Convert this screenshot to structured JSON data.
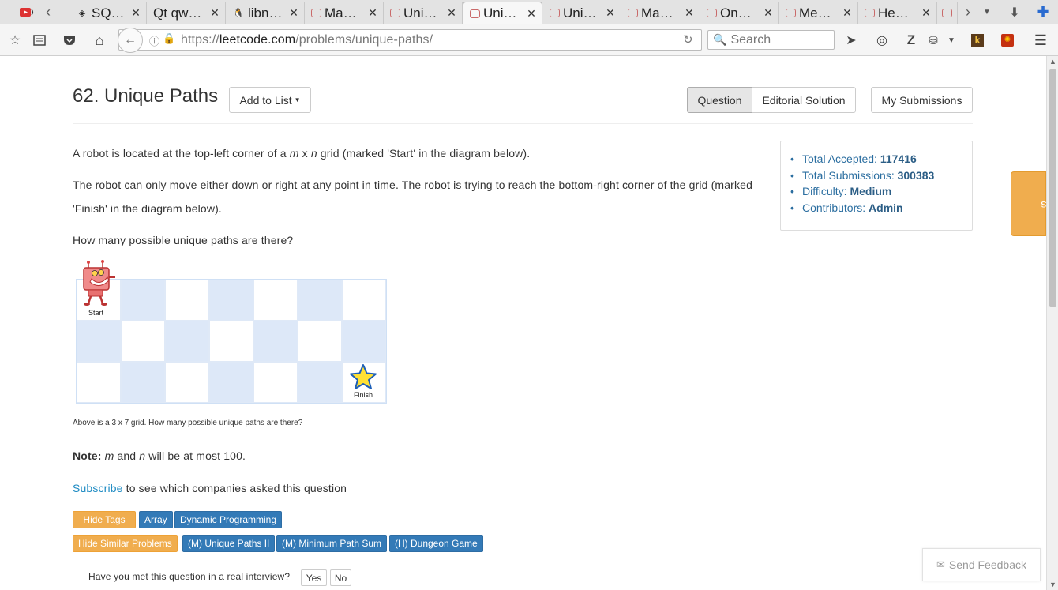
{
  "browser": {
    "tabs": [
      {
        "title": "SQ…",
        "icon": "sql-icon"
      },
      {
        "title": "Qt qw…",
        "icon": "qt-icon"
      },
      {
        "title": "libn…",
        "icon": "linux-icon"
      },
      {
        "title": "Ma…",
        "icon": "leetcode-icon"
      },
      {
        "title": "Uni…",
        "icon": "leetcode-icon"
      },
      {
        "title": "Uni…",
        "icon": "leetcode-icon"
      },
      {
        "title": "Uni…",
        "icon": "leetcode-icon"
      },
      {
        "title": "Ma…",
        "icon": "leetcode-icon"
      },
      {
        "title": "On…",
        "icon": "leetcode-icon"
      },
      {
        "title": "Me…",
        "icon": "leetcode-icon"
      },
      {
        "title": "He…",
        "icon": "leetcode-icon"
      }
    ],
    "url_prefix": "https://",
    "url_host": "leetcode.com",
    "url_path": "/problems/unique-paths/",
    "search_placeholder": "Search"
  },
  "problem": {
    "title": "62. Unique Paths",
    "add_to_list": "Add to List",
    "tabs": {
      "question": "Question",
      "editorial": "Editorial Solution",
      "submissions": "My Submissions"
    },
    "para1_a": "A robot is located at the top-left corner of a ",
    "para1_m": "m",
    "para1_x": " x ",
    "para1_n": "n",
    "para1_b": " grid (marked 'Start' in the diagram below).",
    "para2_line1": "The robot can only move either down or right at any point in time. The robot is trying to reach the bottom-right corner of the grid (marked",
    "para2_line2": "'Finish' in the diagram below).",
    "para3": "How many possible unique paths are there?",
    "grid_start": "Start",
    "grid_finish": "Finish",
    "caption": "Above is a 3 x 7 grid. How many possible unique paths are there?",
    "note_label": "Note:",
    "note_m": "m",
    "note_and": " and ",
    "note_n": "n",
    "note_rest": " will be at most 100.",
    "subscribe_link": "Subscribe",
    "subscribe_rest": " to see which companies asked this question",
    "hide_tags": "Hide Tags",
    "tags": [
      "Array",
      "Dynamic Programming"
    ],
    "hide_similar": "Hide Similar Problems",
    "similar": [
      "(M) Unique Paths II",
      "(M) Minimum Path Sum",
      "(H) Dungeon Game"
    ],
    "interview_q": "Have you met this question in a real interview?",
    "yes": "Yes",
    "no": "No"
  },
  "stats": {
    "accepted_label": "Total Accepted: ",
    "accepted_value": "117416",
    "submissions_label": "Total Submissions: ",
    "submissions_value": "300383",
    "difficulty_label": "Difficulty: ",
    "difficulty_value": "Medium",
    "contributors_label": "Contributors: ",
    "contributors_value": "Admin"
  },
  "sidebar": {
    "notes": "Notes"
  },
  "feedback": {
    "label": "Send Feedback"
  },
  "colors": {
    "accent_blue": "#337ab7",
    "accent_orange": "#f0ad4e",
    "grid_blue": "#dde8f8"
  }
}
